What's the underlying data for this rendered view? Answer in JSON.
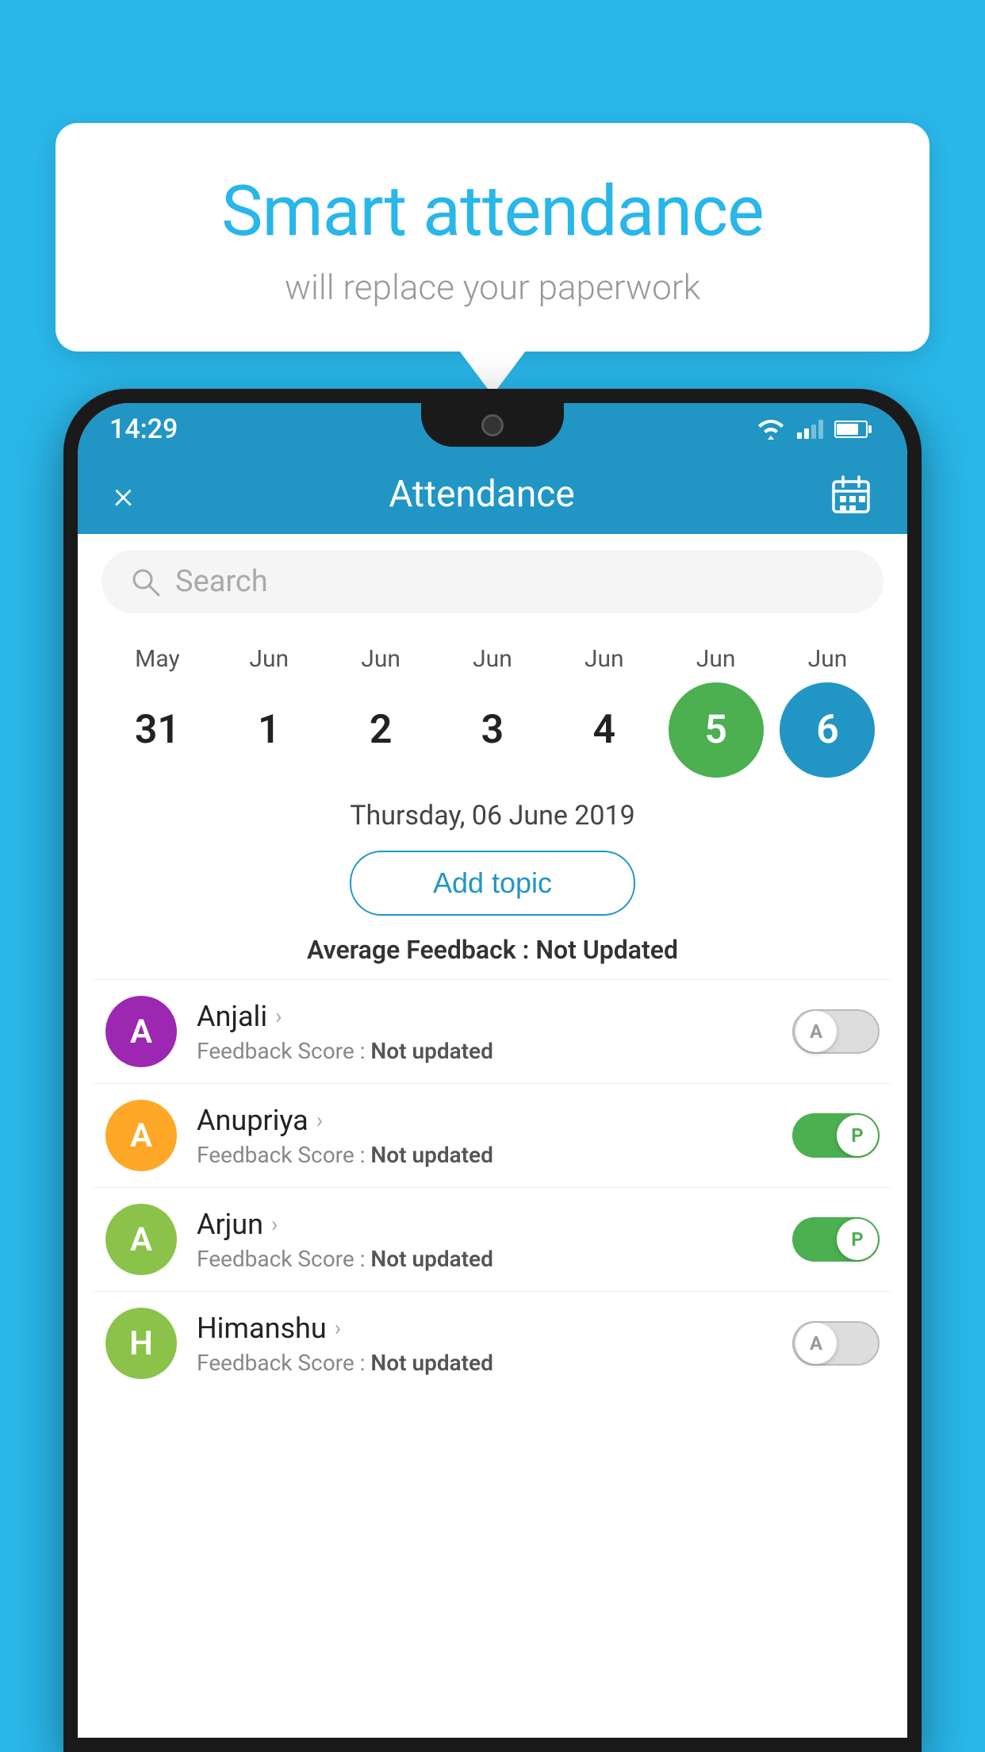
{
  "background_color": "#29b6e8",
  "bubble": {
    "title": "Smart attendance",
    "subtitle": "will replace your paperwork"
  },
  "status_bar": {
    "time": "14:29"
  },
  "header": {
    "title": "Attendance",
    "close_label": "×",
    "calendar_icon": "calendar-icon"
  },
  "search": {
    "placeholder": "Search"
  },
  "calendar": {
    "months": [
      "May",
      "Jun",
      "Jun",
      "Jun",
      "Jun",
      "Jun",
      "Jun"
    ],
    "dates": [
      31,
      1,
      2,
      3,
      4,
      5,
      6
    ],
    "today_index": 5,
    "selected_index": 6
  },
  "selected_date": "Thursday, 06 June 2019",
  "add_topic_label": "Add topic",
  "avg_feedback": {
    "label": "Average Feedback : ",
    "value": "Not Updated"
  },
  "students": [
    {
      "name": "Anjali",
      "avatar_letter": "A",
      "avatar_color": "#9c27b0",
      "feedback_label": "Feedback Score : ",
      "feedback_value": "Not updated",
      "attendance": "absent",
      "toggle_letter": "A"
    },
    {
      "name": "Anupriya",
      "avatar_letter": "A",
      "avatar_color": "#ffa726",
      "feedback_label": "Feedback Score : ",
      "feedback_value": "Not updated",
      "attendance": "present",
      "toggle_letter": "P"
    },
    {
      "name": "Arjun",
      "avatar_letter": "A",
      "avatar_color": "#8bc34a",
      "feedback_label": "Feedback Score : ",
      "feedback_value": "Not updated",
      "attendance": "present",
      "toggle_letter": "P"
    },
    {
      "name": "Himanshu",
      "avatar_letter": "H",
      "avatar_color": "#8bc34a",
      "feedback_label": "Feedback Score : ",
      "feedback_value": "Not updated",
      "attendance": "absent",
      "toggle_letter": "A"
    }
  ]
}
